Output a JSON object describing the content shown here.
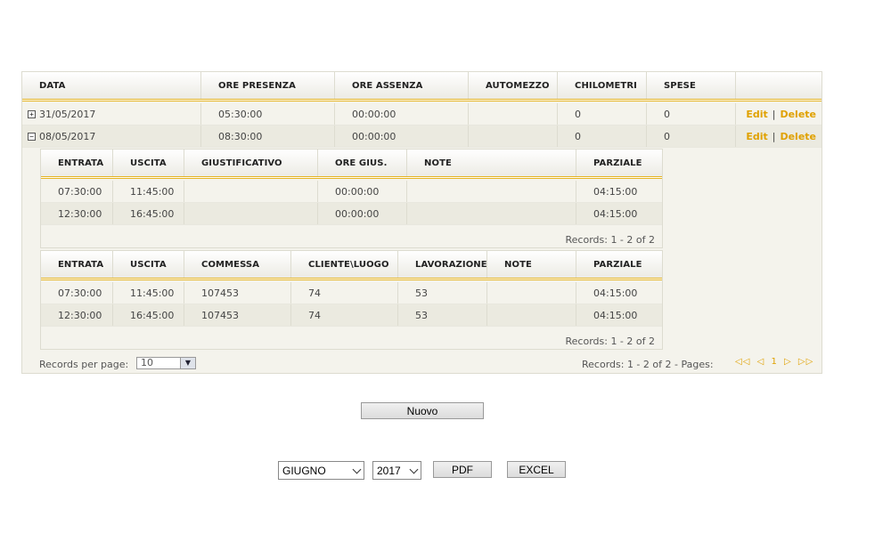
{
  "main_grid": {
    "headers": [
      "DATA",
      "ORE PRESENZA",
      "ORE ASSENZA",
      "AUTOMEZZO",
      "CHILOMETRI",
      "SPESE",
      ""
    ],
    "rows": [
      {
        "toggle": "+",
        "data": "31/05/2017",
        "ore_presenza": "05:30:00",
        "ore_assenza": "00:00:00",
        "automezzo": "",
        "chilometri": "0",
        "spese": "0"
      },
      {
        "toggle": "−",
        "data": "08/05/2017",
        "ore_presenza": "08:30:00",
        "ore_assenza": "00:00:00",
        "automezzo": "",
        "chilometri": "0",
        "spese": "0"
      }
    ],
    "edit_label": "Edit",
    "delete_label": "Delete",
    "separator": "|"
  },
  "sub_grid_1": {
    "headers": [
      "ENTRATA",
      "USCITA",
      "GIUSTIFICATIVO",
      "ORE GIUS.",
      "NOTE",
      "PARZIALE"
    ],
    "rows": [
      [
        "07:30:00",
        "11:45:00",
        "",
        "00:00:00",
        "",
        "04:15:00"
      ],
      [
        "12:30:00",
        "16:45:00",
        "",
        "00:00:00",
        "",
        "04:15:00"
      ]
    ],
    "footer": "Records: 1 - 2 of 2"
  },
  "sub_grid_2": {
    "headers": [
      "ENTRATA",
      "USCITA",
      "COMMESSA",
      "CLIENTE\\LUOGO",
      "LAVORAZIONE",
      "NOTE",
      "PARZIALE"
    ],
    "rows": [
      [
        "07:30:00",
        "11:45:00",
        "107453",
        "74",
        "53",
        "",
        "04:15:00"
      ],
      [
        "12:30:00",
        "16:45:00",
        "107453",
        "74",
        "53",
        "",
        "04:15:00"
      ]
    ],
    "footer": "Records: 1 - 2 of 2"
  },
  "pager": {
    "per_page_label": "Records per page:",
    "per_page_value": "10",
    "summary": "Records: 1 - 2 of 2 - Pages:",
    "first": "◁◁",
    "prev": "◁",
    "current_page": "1",
    "next": "▷",
    "last": "▷▷"
  },
  "nuovo_label": "Nuovo",
  "filters": {
    "month": "GIUGNO",
    "year": "2017",
    "pdf_label": "PDF",
    "excel_label": "EXCEL"
  }
}
